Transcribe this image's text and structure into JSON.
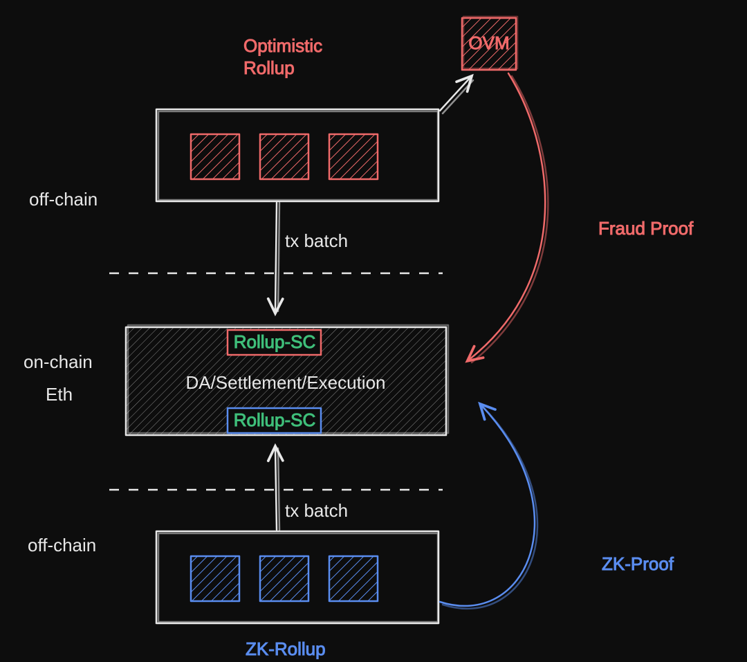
{
  "title_optimistic": "Optimistic\nRollup",
  "title_zk": "ZK-Rollup",
  "label_off_top": "off-chain",
  "label_off_bottom": "off-chain",
  "label_on_chain": "on-chain",
  "label_eth": "Eth",
  "label_ovm": "OVM",
  "label_middle": "DA/Settlement/Execution",
  "label_rollup_sc_top": "Rollup-SC",
  "label_rollup_sc_bottom": "Rollup-SC",
  "label_tx_batch_top": "tx batch",
  "label_tx_batch_bottom": "tx batch",
  "label_fraud_proof": "Fraud Proof",
  "label_zk_proof": "ZK-Proof",
  "colors": {
    "red": "#f06a6a",
    "blue": "#5a8df0",
    "green": "#3fbf7a",
    "white": "#e8e8e8",
    "bg": "#0d0d0d"
  },
  "diagram": {
    "type": "architecture",
    "nodes": [
      {
        "id": "optimistic-rollup",
        "layer": "off-chain",
        "color": "red",
        "contains": [
          "tx",
          "tx",
          "tx"
        ]
      },
      {
        "id": "ovm",
        "layer": "off-chain",
        "color": "red"
      },
      {
        "id": "eth-settlement",
        "layer": "on-chain",
        "color": "white",
        "contains": [
          "Rollup-SC(red)",
          "Rollup-SC(blue)"
        ]
      },
      {
        "id": "zk-rollup",
        "layer": "off-chain",
        "color": "blue",
        "contains": [
          "tx",
          "tx",
          "tx"
        ]
      }
    ],
    "edges": [
      {
        "from": "optimistic-rollup",
        "to": "eth-settlement",
        "label": "tx batch"
      },
      {
        "from": "zk-rollup",
        "to": "eth-settlement",
        "label": "tx batch"
      },
      {
        "from": "optimistic-rollup",
        "to": "ovm",
        "label": ""
      },
      {
        "from": "ovm",
        "to": "eth-settlement",
        "label": "Fraud Proof",
        "color": "red"
      },
      {
        "from": "zk-rollup",
        "to": "eth-settlement",
        "label": "ZK-Proof",
        "color": "blue"
      }
    ]
  }
}
